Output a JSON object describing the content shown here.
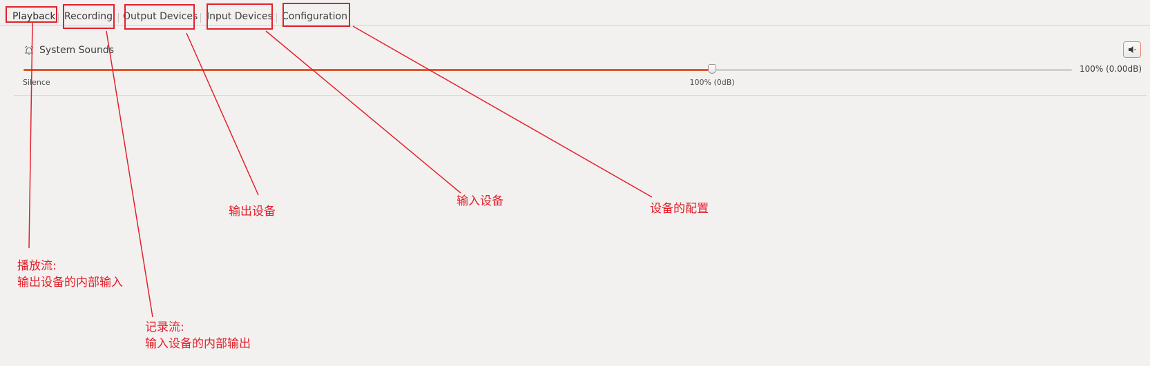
{
  "tabs": [
    {
      "label": "Playback",
      "active": true
    },
    {
      "label": "Recording",
      "active": false
    },
    {
      "label": "Output Devices",
      "active": false
    },
    {
      "label": "Input Devices",
      "active": false
    },
    {
      "label": "Configuration",
      "active": false
    }
  ],
  "stream": {
    "name": "System Sounds",
    "icon": "bell-icon",
    "volume_text": "100% (0.00dB)",
    "volume_fraction": 0.657,
    "scale_silence": "Silence",
    "scale_unity": "100% (0dB)",
    "mute_icon": "speaker-icon"
  },
  "annotations": {
    "playback_title": "播放流:",
    "playback_desc": "输出设备的内部输入",
    "recording_title": "记录流:",
    "recording_desc": "输入设备的内部输出",
    "output_devices": "输出设备",
    "input_devices": "输入设备",
    "configuration": "设备的配置"
  },
  "colors": {
    "annotation": "#e3202c",
    "slider_fill": "#e1562b",
    "background": "#f3f1ef"
  }
}
